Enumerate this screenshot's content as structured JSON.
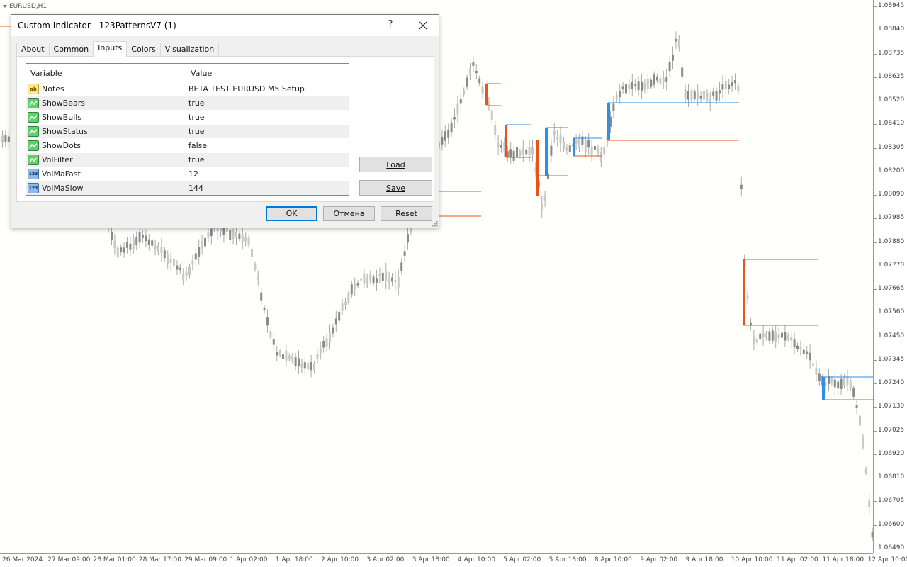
{
  "chart": {
    "symbol": "EURUSD,H1",
    "price_labels": [
      "1.08945",
      "1.08840",
      "1.08735",
      "1.08625",
      "1.08520",
      "1.08410",
      "1.08305",
      "1.08200",
      "1.08090",
      "1.07985",
      "1.07880",
      "1.07770",
      "1.07665",
      "1.07560",
      "1.07450",
      "1.07345",
      "1.07240",
      "1.07130",
      "1.07025",
      "1.06920",
      "1.06810",
      "1.06705",
      "1.06600",
      "1.06490"
    ],
    "time_labels": [
      "26 Mar 2024",
      "27 Mar 09:00",
      "28 Mar 01:00",
      "28 Mar 17:00",
      "29 Mar 09:00",
      "1 Apr 02:00",
      "1 Apr 18:00",
      "2 Apr 10:00",
      "3 Apr 02:00",
      "3 Apr 18:00",
      "4 Apr 10:00",
      "5 Apr 02:00",
      "5 Apr 18:00",
      "8 Apr 10:00",
      "9 Apr 02:00",
      "9 Apr 18:00",
      "10 Apr 10:00",
      "11 Apr 02:00",
      "11 Apr 18:00",
      "12 Apr 10:00"
    ],
    "colors": {
      "candle": "#8a8a8a",
      "bull": "#2f8fe6",
      "bear": "#e8541c",
      "background": "#fffffc"
    }
  },
  "dialog": {
    "title": "Custom Indicator - 123PatternsV7 (1)",
    "help_label": "?",
    "tabs": [
      {
        "label": "About"
      },
      {
        "label": "Common"
      },
      {
        "label": "Inputs",
        "active": true
      },
      {
        "label": "Colors"
      },
      {
        "label": "Visualization"
      }
    ],
    "grid": {
      "header_variable": "Variable",
      "header_value": "Value",
      "rows": [
        {
          "type_icon": "string-icon",
          "type_text": "ab",
          "variable": "Notes",
          "value": "BETA TEST EURUSD M5 Setup"
        },
        {
          "type_icon": "bool-icon",
          "type_text": "",
          "variable": "ShowBears",
          "value": "true"
        },
        {
          "type_icon": "bool-icon",
          "type_text": "",
          "variable": "ShowBulls",
          "value": "true"
        },
        {
          "type_icon": "bool-icon",
          "type_text": "",
          "variable": "ShowStatus",
          "value": "true"
        },
        {
          "type_icon": "bool-icon",
          "type_text": "",
          "variable": "ShowDots",
          "value": "false"
        },
        {
          "type_icon": "bool-icon",
          "type_text": "",
          "variable": "VolFilter",
          "value": "true"
        },
        {
          "type_icon": "int-icon",
          "type_text": "123",
          "variable": "VolMaFast",
          "value": "12"
        },
        {
          "type_icon": "int-icon",
          "type_text": "123",
          "variable": "VolMaSlow",
          "value": "144"
        }
      ]
    },
    "load_label": "Load",
    "save_label": "Save",
    "ok_label": "OK",
    "cancel_label": "Отмена",
    "reset_label": "Reset"
  }
}
